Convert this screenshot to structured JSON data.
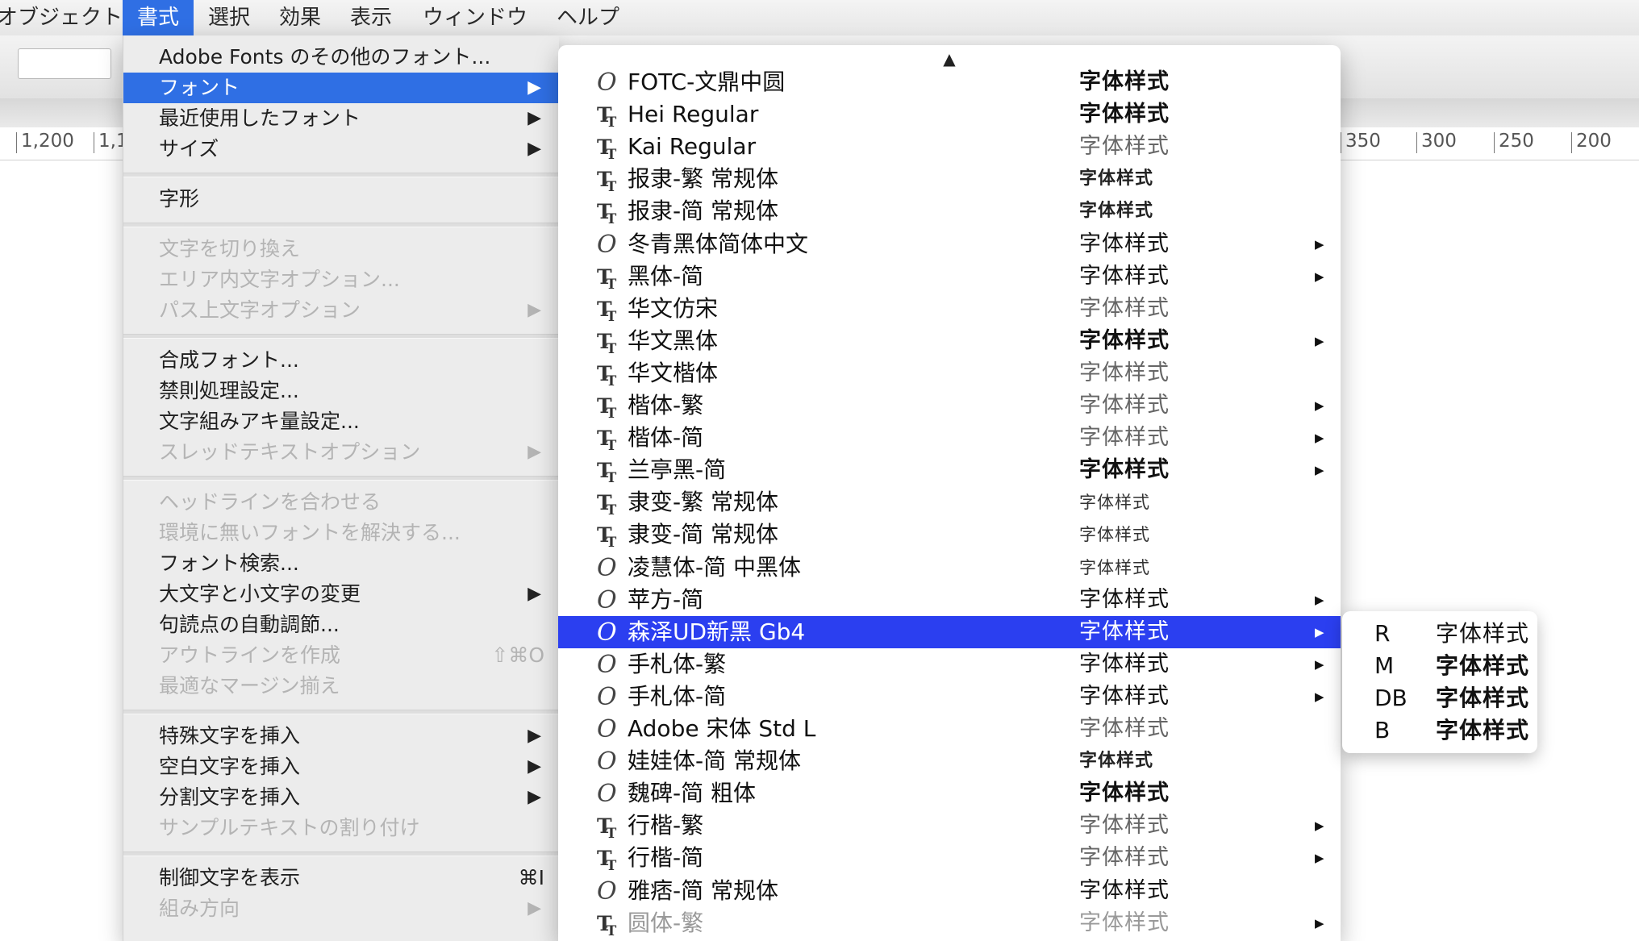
{
  "menubar": {
    "items": [
      "オブジェクト",
      "書式",
      "選択",
      "効果",
      "表示",
      "ウィンドウ",
      "ヘルプ"
    ],
    "active": "書式"
  },
  "ruler": {
    "left_labels": [
      "1,200",
      "1,1"
    ],
    "right_labels": [
      "350",
      "300",
      "250",
      "200"
    ]
  },
  "main_menu": {
    "items": [
      {
        "label": "Adobe Fonts のその他のフォント...",
        "state": "enabled"
      },
      {
        "label": "フォント",
        "state": "highlighted",
        "submenu": true
      },
      {
        "label": "最近使用したフォント",
        "state": "enabled",
        "submenu": true
      },
      {
        "label": "サイズ",
        "state": "enabled",
        "submenu": true
      },
      {
        "label": "字形",
        "state": "enabled"
      },
      {
        "label": "文字を切り換え",
        "state": "disabled"
      },
      {
        "label": "エリア内文字オプション...",
        "state": "disabled"
      },
      {
        "label": "パス上文字オプション",
        "state": "disabled",
        "submenu": true
      },
      {
        "label": "合成フォント...",
        "state": "enabled"
      },
      {
        "label": "禁則処理設定...",
        "state": "enabled"
      },
      {
        "label": "文字組みアキ量設定...",
        "state": "enabled"
      },
      {
        "label": "スレッドテキストオプション",
        "state": "disabled",
        "submenu": true
      },
      {
        "label": "ヘッドラインを合わせる",
        "state": "disabled"
      },
      {
        "label": "環境に無いフォントを解決する...",
        "state": "disabled"
      },
      {
        "label": "フォント検索...",
        "state": "enabled"
      },
      {
        "label": "大文字と小文字の変更",
        "state": "enabled",
        "submenu": true
      },
      {
        "label": "句読点の自動調節...",
        "state": "enabled"
      },
      {
        "label": "アウトラインを作成",
        "state": "disabled",
        "shortcut": "⇧⌘O"
      },
      {
        "label": "最適なマージン揃え",
        "state": "disabled"
      },
      {
        "label": "特殊文字を挿入",
        "state": "enabled",
        "submenu": true
      },
      {
        "label": "空白文字を挿入",
        "state": "enabled",
        "submenu": true
      },
      {
        "label": "分割文字を挿入",
        "state": "enabled",
        "submenu": true
      },
      {
        "label": "サンプルテキストの割り付け",
        "state": "disabled"
      },
      {
        "label": "制御文字を表示",
        "state": "enabled",
        "shortcut": "⌘I"
      },
      {
        "label": "組み方向",
        "state": "disabled",
        "submenu": true
      }
    ]
  },
  "font_menu": {
    "scroll_up_glyph": "▲",
    "sample_text": "字体样式",
    "fonts": [
      {
        "name": "FOTC-文鼎中圆",
        "icon": "opentype",
        "sample_style": "bold",
        "submenu": false
      },
      {
        "name": "Hei Regular",
        "icon": "truetype",
        "sample_style": "bold",
        "submenu": false
      },
      {
        "name": "Kai Regular",
        "icon": "truetype",
        "sample_style": "light",
        "submenu": false
      },
      {
        "name": "报隶-繁 常规体",
        "icon": "truetype",
        "sample_style": "small",
        "submenu": false
      },
      {
        "name": "报隶-简 常规体",
        "icon": "truetype",
        "sample_style": "small",
        "submenu": false
      },
      {
        "name": "冬青黑体简体中文",
        "icon": "opentype",
        "sample_style": "normal",
        "submenu": true
      },
      {
        "name": "黑体-简",
        "icon": "truetype",
        "sample_style": "normal",
        "submenu": true
      },
      {
        "name": "华文仿宋",
        "icon": "truetype",
        "sample_style": "light",
        "submenu": false
      },
      {
        "name": "华文黑体",
        "icon": "truetype",
        "sample_style": "bold",
        "submenu": true
      },
      {
        "name": "华文楷体",
        "icon": "truetype",
        "sample_style": "light",
        "submenu": false
      },
      {
        "name": "楷体-繁",
        "icon": "truetype",
        "sample_style": "light",
        "submenu": true
      },
      {
        "name": "楷体-简",
        "icon": "truetype",
        "sample_style": "light",
        "submenu": true
      },
      {
        "name": "兰亭黑-简",
        "icon": "truetype",
        "sample_style": "bold",
        "submenu": true
      },
      {
        "name": "隶变-繁 常规体",
        "icon": "truetype",
        "sample_style": "tiny",
        "submenu": false
      },
      {
        "name": "隶变-简 常规体",
        "icon": "truetype",
        "sample_style": "tiny",
        "submenu": false
      },
      {
        "name": "凌慧体-简 中黑体",
        "icon": "opentype",
        "sample_style": "tiny",
        "submenu": false
      },
      {
        "name": "苹方-简",
        "icon": "opentype",
        "sample_style": "normal",
        "submenu": true
      },
      {
        "name": "森泽UD新黑 Gb4",
        "icon": "opentype",
        "sample_style": "normal",
        "submenu": true,
        "selected": true
      },
      {
        "name": "手札体-繁",
        "icon": "opentype",
        "sample_style": "normal",
        "submenu": true
      },
      {
        "name": "手札体-简",
        "icon": "opentype",
        "sample_style": "normal",
        "submenu": true
      },
      {
        "name": "Adobe 宋体 Std L",
        "icon": "opentype",
        "sample_style": "light",
        "submenu": false
      },
      {
        "name": "娃娃体-简 常规体",
        "icon": "opentype",
        "sample_style": "small",
        "submenu": false
      },
      {
        "name": "魏碑-简 粗体",
        "icon": "opentype",
        "sample_style": "bold",
        "submenu": false
      },
      {
        "name": "行楷-繁",
        "icon": "truetype",
        "sample_style": "light",
        "submenu": true
      },
      {
        "name": "行楷-简",
        "icon": "truetype",
        "sample_style": "light",
        "submenu": true
      },
      {
        "name": "雅痞-简 常规体",
        "icon": "opentype",
        "sample_style": "normal",
        "submenu": false
      },
      {
        "name": "圆体-繁",
        "icon": "truetype",
        "sample_style": "light",
        "submenu": true,
        "cut": true
      }
    ]
  },
  "style_menu": {
    "sample_text": "字体样式",
    "styles": [
      "R",
      "M",
      "DB",
      "B"
    ]
  }
}
